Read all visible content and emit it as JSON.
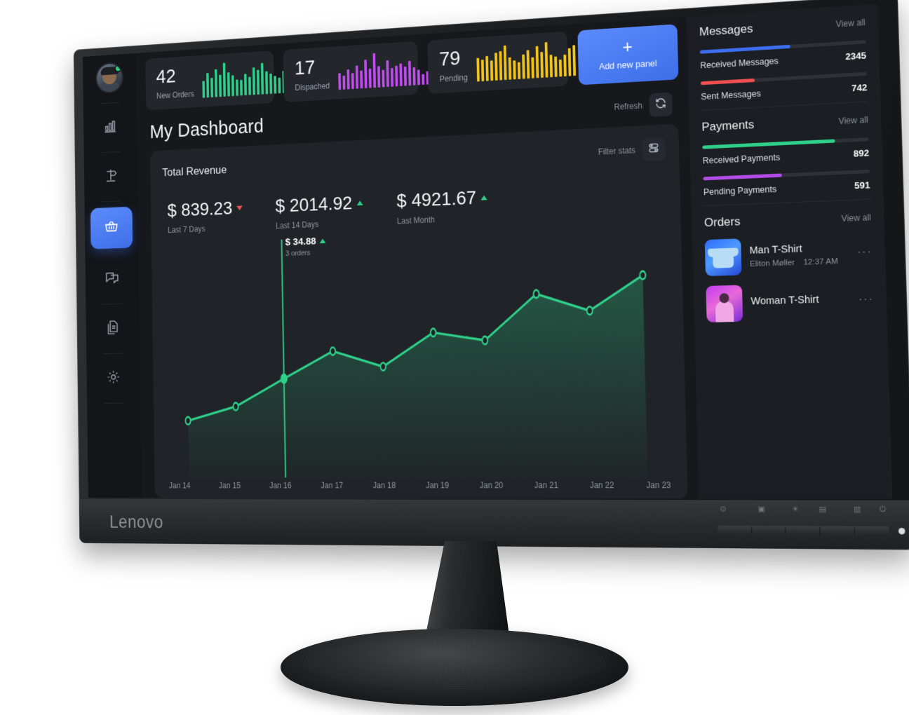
{
  "device": {
    "brand": "Lenovo"
  },
  "profile": {
    "name": "avatar",
    "status": "online"
  },
  "sidebar": {
    "items": [
      {
        "icon": "bar-chart-icon",
        "name": "analytics",
        "active": false
      },
      {
        "icon": "signpost-icon",
        "name": "campaigns",
        "active": false
      },
      {
        "icon": "basket-icon",
        "name": "orders",
        "active": true
      },
      {
        "icon": "chat-icon",
        "name": "messages",
        "active": false
      },
      {
        "icon": "documents-icon",
        "name": "documents",
        "active": false
      },
      {
        "icon": "gear-icon",
        "name": "settings",
        "active": false
      }
    ]
  },
  "stats": [
    {
      "value": "42",
      "label": "New Orders",
      "color": "#2fd08a",
      "bars": [
        34,
        55,
        41,
        62,
        48,
        78,
        52,
        44,
        33,
        30,
        46,
        38,
        61,
        55,
        72,
        50,
        43,
        36,
        30,
        48,
        41,
        28
      ]
    },
    {
      "value": "17",
      "label": "Dispached",
      "color": "#c04cf0",
      "bars": [
        38,
        30,
        48,
        36,
        58,
        42,
        74,
        46,
        92,
        52,
        40,
        68,
        44,
        50,
        56,
        46,
        62,
        42,
        34,
        20,
        28,
        40
      ]
    },
    {
      "value": "79",
      "label": "Pending",
      "color": "#f2c417",
      "bars": [
        46,
        42,
        50,
        38,
        56,
        60,
        72,
        44,
        36,
        30,
        48,
        58,
        40,
        66,
        52,
        74,
        44,
        38,
        30,
        42,
        56,
        62
      ]
    }
  ],
  "add_panel": {
    "label": "Add new panel",
    "icon": "plus-icon",
    "color": "#4a7ef0"
  },
  "header": {
    "title": "My Dashboard",
    "refresh_label": "Refresh",
    "refresh_icon": "refresh-icon"
  },
  "revenue": {
    "title": "Total Revenue",
    "filter_label": "Filter stats",
    "filter_icon": "sliders-icon",
    "totals": [
      {
        "value": "$ 839.23",
        "period": "Last 7 Days",
        "trend": "down"
      },
      {
        "value": "$ 2014.92",
        "period": "Last 14 Days",
        "trend": "up"
      },
      {
        "value": "$ 4921.67",
        "period": "Last Month",
        "trend": "up"
      }
    ],
    "tooltip": {
      "value": "$ 34.88",
      "orders": "3 orders",
      "trend": "up"
    }
  },
  "chart_data": {
    "type": "line",
    "title": "Total Revenue",
    "xlabel": "",
    "ylabel": "",
    "grid": false,
    "legend": "none",
    "line_color": "#2fd08a",
    "area_fill": "#2fd08a",
    "categories": [
      "Jan 14",
      "Jan 15",
      "Jan 16",
      "Jan 17",
      "Jan 18",
      "Jan 19",
      "Jan 20",
      "Jan 21",
      "Jan 22",
      "Jan 23"
    ],
    "values": [
      18.5,
      24.0,
      34.88,
      45.5,
      39.0,
      52.0,
      48.5,
      66.0,
      59.0,
      72.0
    ],
    "ylim": [
      0,
      80
    ],
    "highlight_index": 2,
    "annotations": [
      {
        "index": 2,
        "label": "$ 34.88",
        "sublabel": "3 orders"
      }
    ]
  },
  "messages": {
    "title": "Messages",
    "view_all": "View all",
    "rows": [
      {
        "label": "Received Messages",
        "value": "2345",
        "pct": 55,
        "color": "#3d6ef0"
      },
      {
        "label": "Sent Messages",
        "value": "742",
        "pct": 33,
        "color": "#f05050"
      }
    ]
  },
  "payments": {
    "title": "Payments",
    "view_all": "View all",
    "rows": [
      {
        "label": "Received Payments",
        "value": "892",
        "pct": 80,
        "color": "#2fd08a"
      },
      {
        "label": "Pending Payments",
        "value": "591",
        "pct": 48,
        "color": "#b44ce8"
      }
    ]
  },
  "orders": {
    "title": "Orders",
    "view_all": "View all",
    "items": [
      {
        "name": "Man T-Shirt",
        "customer": "Eliton Møller",
        "time": "12:37 AM",
        "thumb": "blue",
        "menu": "···"
      },
      {
        "name": "Woman T-Shirt",
        "customer": "",
        "time": "",
        "thumb": "purple",
        "menu": "···"
      }
    ]
  },
  "osd": {
    "glyphs": [
      "⊙",
      "▣",
      "☀",
      "▤",
      "▥",
      "⏻"
    ]
  }
}
